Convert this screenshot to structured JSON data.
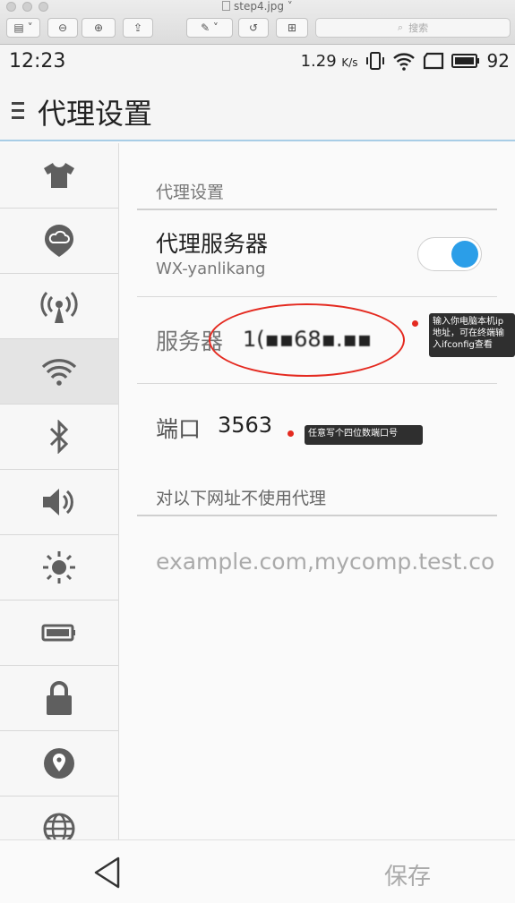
{
  "mac": {
    "title": "step4.jpg",
    "search_placeholder": "搜索"
  },
  "status": {
    "time": "12:23",
    "speed": "1.29",
    "speed_unit": "K/s",
    "battery": "92"
  },
  "header": {
    "title": "代理设置"
  },
  "nav": {
    "items": [
      {
        "icon": "tshirt-icon"
      },
      {
        "icon": "cloud-pin-icon"
      },
      {
        "icon": "antenna-icon"
      },
      {
        "icon": "wifi-icon",
        "active": true
      },
      {
        "icon": "bluetooth-icon"
      },
      {
        "icon": "volume-icon"
      },
      {
        "icon": "brightness-icon"
      },
      {
        "icon": "battery-icon"
      },
      {
        "icon": "lock-icon"
      },
      {
        "icon": "location-icon"
      },
      {
        "icon": "globe-icon"
      }
    ]
  },
  "content": {
    "section_title": "代理设置",
    "proxy_server": {
      "label": "代理服务器",
      "value": "WX-yanlikang",
      "enabled": true
    },
    "server": {
      "label": "服务器",
      "value": "1(▪▪68▪.▪▪"
    },
    "port": {
      "label": "端口",
      "value": "3563"
    },
    "bypass": {
      "label": "对以下网址不使用代理",
      "placeholder": "example.com,mycomp.test.co"
    }
  },
  "annotations": {
    "server_tip": "输入你电脑本机ip地址，可在终端输入ifconfig查看",
    "port_tip": "任意写个四位数端口号"
  },
  "bottom": {
    "save_label": "保存"
  },
  "colors": {
    "accent": "#2b9ee8",
    "annotation": "#e42a20"
  }
}
